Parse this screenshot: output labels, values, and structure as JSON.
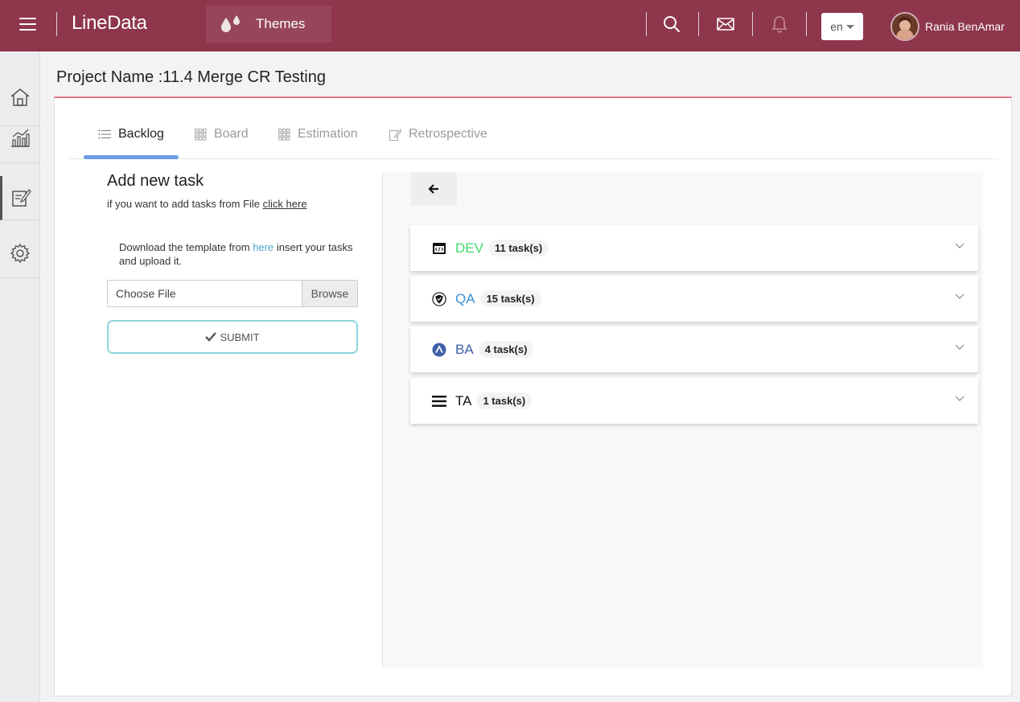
{
  "header": {
    "brand": "LineData",
    "themes_label": "Themes",
    "language": "en",
    "user_name": "Rania BenAmar"
  },
  "sidebar": {
    "items": [
      {
        "icon": "home-icon"
      },
      {
        "icon": "chart-icon"
      },
      {
        "icon": "edit-icon",
        "active": true
      },
      {
        "icon": "gear-icon"
      }
    ]
  },
  "page": {
    "title": "Project Name :11.4 Merge CR Testing"
  },
  "tabs": [
    {
      "label": "Backlog",
      "active": true
    },
    {
      "label": "Board"
    },
    {
      "label": "Estimation"
    },
    {
      "label": "Retrospective"
    }
  ],
  "add_task": {
    "title": "Add new task",
    "subtitle_prefix": "if you want to add tasks from File ",
    "subtitle_link": "click here",
    "note_prefix": "Download the template from ",
    "note_link": "here",
    "note_suffix": " insert your tasks and upload it.",
    "file_placeholder": "Choose File",
    "browse_label": "Browse",
    "submit_label": "SUBMIT"
  },
  "teams": [
    {
      "name": "DEV",
      "count": "11 task(s)",
      "color": "#3ddc6c",
      "icon": "code-window-icon"
    },
    {
      "name": "QA",
      "count": "15 task(s)",
      "color": "#3a8fd6",
      "icon": "shield-icon"
    },
    {
      "name": "BA",
      "count": "4 task(s)",
      "color": "#3f5fa8",
      "icon": "circle-a-icon"
    },
    {
      "name": "TA",
      "count": "1 task(s)",
      "color": "#111111",
      "icon": "bars-icon"
    }
  ],
  "colors": {
    "topbar": "#8e364c",
    "accent_line": "#e57683",
    "tab_underline": "#6e9ee6",
    "submit_border": "#8fd6dc",
    "link": "#4fa6c8"
  }
}
